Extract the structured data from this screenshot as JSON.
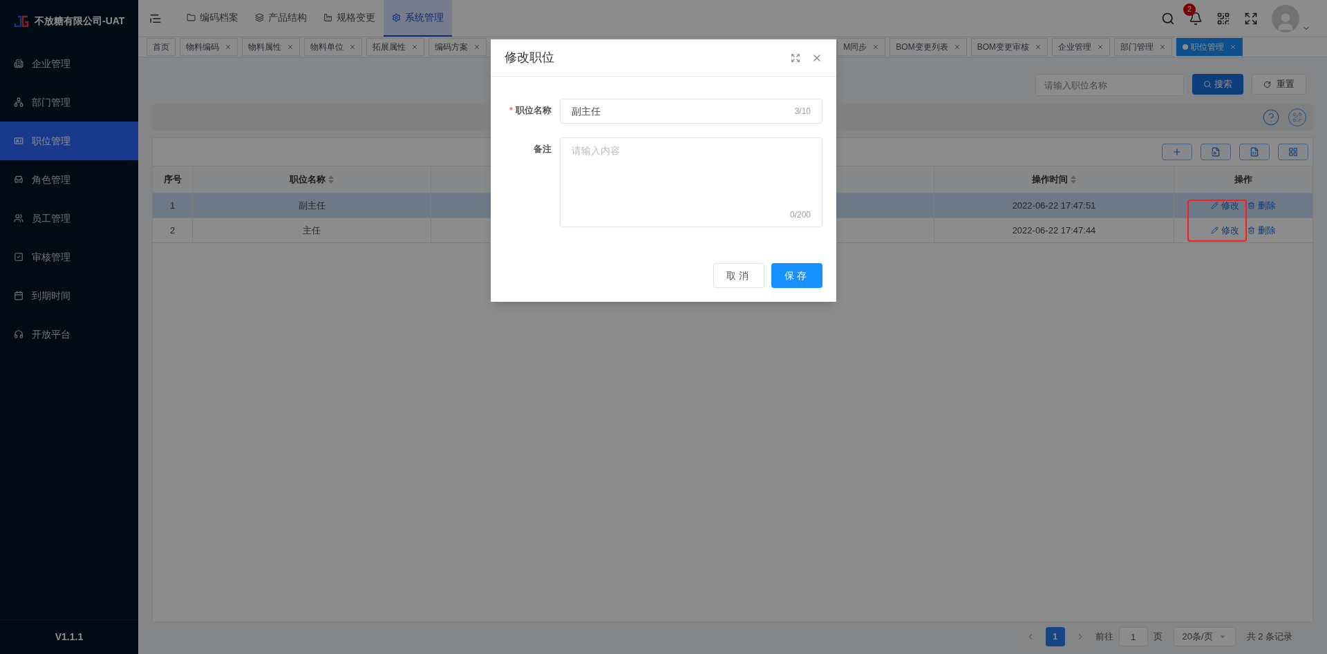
{
  "sidebar": {
    "logo_text": "不放糖有限公司-UAT",
    "items": [
      {
        "label": "企业管理",
        "selected": false
      },
      {
        "label": "部门管理",
        "selected": false
      },
      {
        "label": "职位管理",
        "selected": true
      },
      {
        "label": "角色管理",
        "selected": false
      },
      {
        "label": "员工管理",
        "selected": false
      },
      {
        "label": "审核管理",
        "selected": false
      },
      {
        "label": "到期时间",
        "selected": false
      },
      {
        "label": "开放平台",
        "selected": false
      }
    ],
    "version": "V1.1.1"
  },
  "header": {
    "nav": [
      {
        "label": "编码档案",
        "selected": false
      },
      {
        "label": "产品结构",
        "selected": false
      },
      {
        "label": "规格变更",
        "selected": false
      },
      {
        "label": "系统管理",
        "selected": true
      }
    ],
    "notification_count": "2"
  },
  "tab_bar": {
    "tabs": [
      {
        "label": "首页",
        "selected": false,
        "closable": false
      },
      {
        "label": "物料编码",
        "selected": false,
        "closable": true
      },
      {
        "label": "物料属性",
        "selected": false,
        "closable": true
      },
      {
        "label": "物料单位",
        "selected": false,
        "closable": true
      },
      {
        "label": "拓展属性",
        "selected": false,
        "closable": true
      },
      {
        "label": "编码方案",
        "selected": false,
        "closable": true
      },
      {
        "label": "M同步",
        "selected": false,
        "closable": true
      },
      {
        "label": "BOM变更列表",
        "selected": false,
        "closable": true
      },
      {
        "label": "BOM变更审核",
        "selected": false,
        "closable": true
      },
      {
        "label": "企业管理",
        "selected": false,
        "closable": true
      },
      {
        "label": "部门管理",
        "selected": false,
        "closable": true
      },
      {
        "label": "职位管理",
        "selected": true,
        "closable": true
      }
    ]
  },
  "search": {
    "placeholder": "请输入职位名称",
    "search_button": "搜索",
    "reset_button": "重置"
  },
  "table": {
    "columns": [
      {
        "label": "序号",
        "sortable": false
      },
      {
        "label": "职位名称",
        "sortable": true
      },
      {
        "label": "操作时间",
        "sortable": true
      },
      {
        "label": "操作",
        "sortable": false
      }
    ],
    "rows": [
      {
        "index": "1",
        "name": "副主任",
        "time": "2022-06-22 17:47:51",
        "edit": "修改",
        "delete": "删除",
        "selected": true
      },
      {
        "index": "2",
        "name": "主任",
        "time": "2022-06-22 17:47:44",
        "edit": "修改",
        "delete": "删除",
        "selected": false
      }
    ]
  },
  "pagination": {
    "pages": [
      {
        "label": "1",
        "selected": true
      }
    ],
    "goto_label": "前往",
    "goto_value": "1",
    "page_unit": "页",
    "page_size": "20条/页",
    "total": "共 2 条记录"
  },
  "dialog": {
    "title": "修改职位",
    "fields": [
      {
        "kind": "input",
        "required_mark": "*",
        "label": "职位名称",
        "value": "副主任",
        "counter": "3/10"
      },
      {
        "kind": "textarea",
        "label": "备注",
        "placeholder": "请输入内容",
        "counter": "0/200"
      }
    ],
    "buttons": [
      {
        "label": "取消",
        "kind": "default"
      },
      {
        "label": "保存",
        "kind": "primary"
      }
    ]
  }
}
